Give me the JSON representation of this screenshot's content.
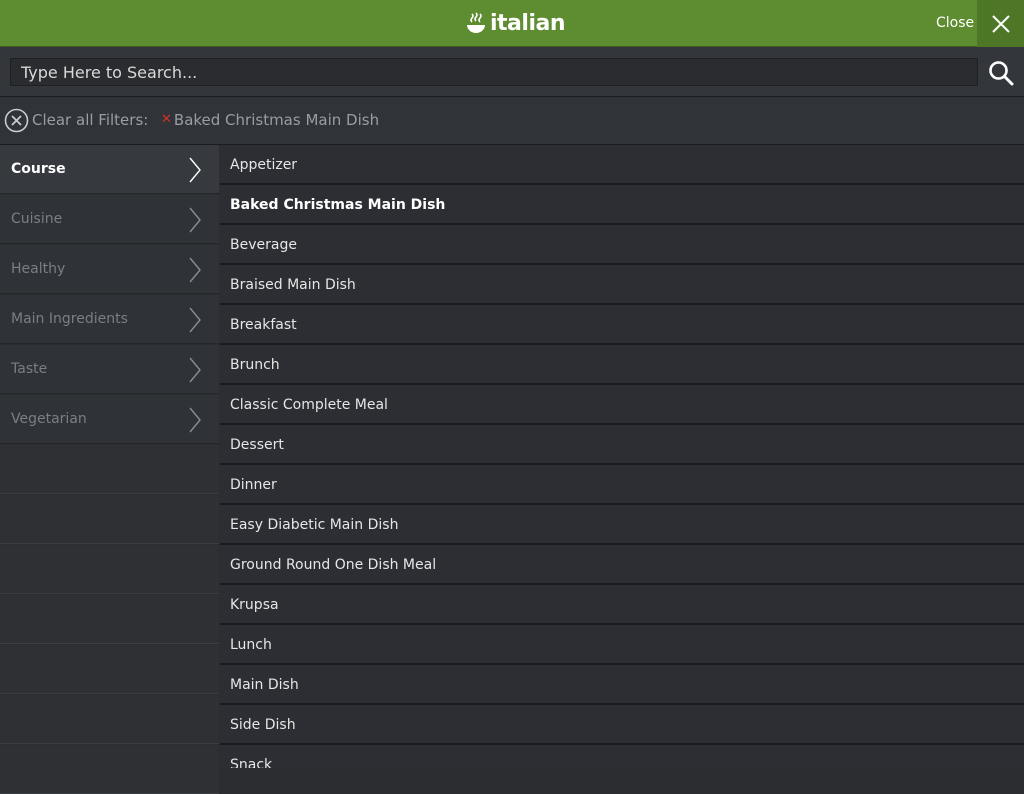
{
  "header": {
    "logo_text": "italian",
    "close_label": "Close"
  },
  "search": {
    "placeholder": "Type Here to Search..."
  },
  "filters": {
    "clear_label": "Clear all Filters:",
    "active": [
      "Baked Christmas Main Dish"
    ]
  },
  "sidebar": {
    "items": [
      {
        "label": "Course",
        "active": true
      },
      {
        "label": "Cuisine",
        "active": false
      },
      {
        "label": "Healthy",
        "active": false
      },
      {
        "label": "Main Ingredients",
        "active": false
      },
      {
        "label": "Taste",
        "active": false
      },
      {
        "label": "Vegetarian",
        "active": false
      }
    ]
  },
  "list": {
    "items": [
      {
        "label": "Appetizer",
        "selected": false
      },
      {
        "label": "Baked Christmas Main Dish",
        "selected": true
      },
      {
        "label": "Beverage",
        "selected": false
      },
      {
        "label": "Braised Main Dish",
        "selected": false
      },
      {
        "label": "Breakfast",
        "selected": false
      },
      {
        "label": "Brunch",
        "selected": false
      },
      {
        "label": "Classic Complete Meal",
        "selected": false
      },
      {
        "label": "Dessert",
        "selected": false
      },
      {
        "label": "Dinner",
        "selected": false
      },
      {
        "label": "Easy Diabetic Main Dish",
        "selected": false
      },
      {
        "label": "Ground Round One Dish Meal",
        "selected": false
      },
      {
        "label": "Krupsa",
        "selected": false
      },
      {
        "label": "Lunch",
        "selected": false
      },
      {
        "label": "Main Dish",
        "selected": false
      },
      {
        "label": "Side Dish",
        "selected": false
      },
      {
        "label": "Snack",
        "selected": false
      }
    ]
  },
  "colors": {
    "header_bg": "#5e8c31",
    "close_bg": "#4d7627",
    "tag_x": "#d2322d"
  }
}
